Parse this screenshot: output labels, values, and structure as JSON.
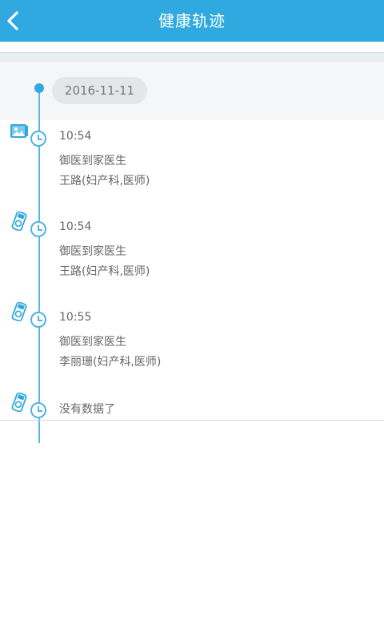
{
  "header": {
    "title": "健康轨迹"
  },
  "timeline": {
    "date": "2016-11-11",
    "entries": [
      {
        "time": "10:54",
        "source": "御医到家医生",
        "doctor": "王路(妇产科,医师)",
        "icon": "image-icon"
      },
      {
        "time": "10:54",
        "source": "御医到家医生",
        "doctor": "王路(妇产科,医师)",
        "icon": "device-icon"
      },
      {
        "time": "10:55",
        "source": "御医到家医生",
        "doctor": "李丽珊(妇产科,医师)",
        "icon": "device-icon"
      }
    ],
    "end_text": "没有数据了",
    "end_icon": "device-icon"
  },
  "colors": {
    "primary": "#2fa9e0",
    "line": "#58b9e4",
    "text": "#666666"
  }
}
